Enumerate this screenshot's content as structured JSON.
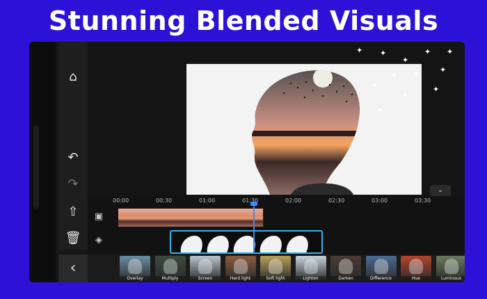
{
  "title": "Stunning Blended Visuals",
  "colors": {
    "background": "#2b12d6",
    "accent": "#29b6f6",
    "playhead": "#3d8bff"
  },
  "sidebar": {
    "icons": [
      "home-icon",
      "undo-icon",
      "redo-icon",
      "export-icon",
      "delete-icon"
    ]
  },
  "timeline": {
    "ticks": [
      "00:00",
      "00:30",
      "01:00",
      "01:30",
      "02:00",
      "02:30",
      "03:00",
      "03:30"
    ]
  },
  "filters": [
    {
      "label": "Overlay",
      "color": "#6b8ea3"
    },
    {
      "label": "Multiply",
      "color": "#3b4a3f"
    },
    {
      "label": "Screen",
      "color": "#b9c6d0"
    },
    {
      "label": "Hard light",
      "color": "#8a5b3e"
    },
    {
      "label": "Soft light",
      "color": "#b8a05a"
    },
    {
      "label": "Lighten",
      "color": "#c9d3dc"
    },
    {
      "label": "Darken",
      "color": "#4a3a32"
    },
    {
      "label": "Difference",
      "color": "#4b6c93"
    },
    {
      "label": "Hue",
      "color": "#b6442c"
    },
    {
      "label": "Luminous",
      "color": "#6a7a5c"
    }
  ]
}
